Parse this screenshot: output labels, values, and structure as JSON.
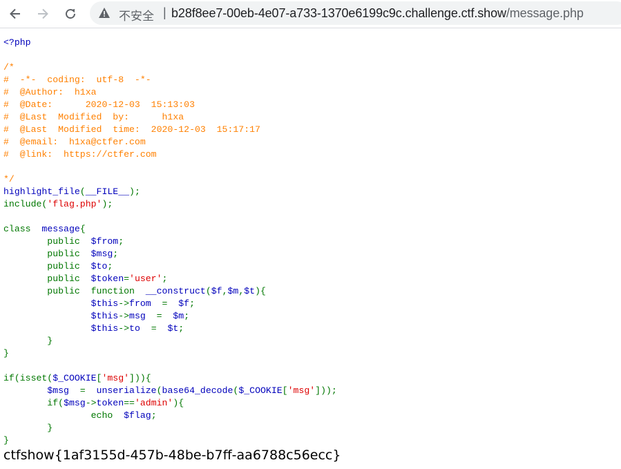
{
  "browser": {
    "back_icon": "arrow-left-icon",
    "forward_icon": "arrow-right-icon",
    "reload_icon": "reload-icon",
    "security_icon": "warning-triangle-icon",
    "security_label": "不安全",
    "separator": "|",
    "url_host": "b28f8ee7-00eb-4e07-a733-1370e6199c9c.challenge.ctf.show",
    "url_path": "/message.php"
  },
  "source_lines": [
    [
      {
        "t": "<?php",
        "c": "html"
      }
    ],
    [],
    [
      {
        "t": "/*",
        "c": "cmt"
      }
    ],
    [
      {
        "t": "#  -*-  coding:  utf-8  -*-",
        "c": "cmt"
      }
    ],
    [
      {
        "t": "#  @Author:  h1xa",
        "c": "cmt"
      }
    ],
    [
      {
        "t": "#  @Date:      2020-12-03  15:13:03",
        "c": "cmt"
      }
    ],
    [
      {
        "t": "#  @Last  Modified  by:      h1xa",
        "c": "cmt"
      }
    ],
    [
      {
        "t": "#  @Last  Modified  time:  2020-12-03  15:17:17",
        "c": "cmt"
      }
    ],
    [
      {
        "t": "#  @email:  h1xa@ctfer.com",
        "c": "cmt"
      }
    ],
    [
      {
        "t": "#  @link:  https://ctfer.com",
        "c": "cmt"
      }
    ],
    [],
    [
      {
        "t": "*/",
        "c": "cmt"
      }
    ],
    [
      {
        "t": "highlight_file",
        "c": "def"
      },
      {
        "t": "(",
        "c": "kw"
      },
      {
        "t": "__FILE__",
        "c": "def"
      },
      {
        "t": ");",
        "c": "kw"
      }
    ],
    [
      {
        "t": "include(",
        "c": "kw"
      },
      {
        "t": "'flag.php'",
        "c": "str"
      },
      {
        "t": ");",
        "c": "kw"
      }
    ],
    [],
    [
      {
        "t": "class  ",
        "c": "kw"
      },
      {
        "t": "message",
        "c": "def"
      },
      {
        "t": "{",
        "c": "kw"
      }
    ],
    [
      {
        "t": "        public  ",
        "c": "kw"
      },
      {
        "t": "$from",
        "c": "def"
      },
      {
        "t": ";",
        "c": "kw"
      }
    ],
    [
      {
        "t": "        public  ",
        "c": "kw"
      },
      {
        "t": "$msg",
        "c": "def"
      },
      {
        "t": ";",
        "c": "kw"
      }
    ],
    [
      {
        "t": "        public  ",
        "c": "kw"
      },
      {
        "t": "$to",
        "c": "def"
      },
      {
        "t": ";",
        "c": "kw"
      }
    ],
    [
      {
        "t": "        public  ",
        "c": "kw"
      },
      {
        "t": "$token",
        "c": "def"
      },
      {
        "t": "=",
        "c": "kw"
      },
      {
        "t": "'user'",
        "c": "str"
      },
      {
        "t": ";",
        "c": "kw"
      }
    ],
    [
      {
        "t": "        public  function  ",
        "c": "kw"
      },
      {
        "t": "__construct",
        "c": "def"
      },
      {
        "t": "(",
        "c": "kw"
      },
      {
        "t": "$f",
        "c": "def"
      },
      {
        "t": ",",
        "c": "kw"
      },
      {
        "t": "$m",
        "c": "def"
      },
      {
        "t": ",",
        "c": "kw"
      },
      {
        "t": "$t",
        "c": "def"
      },
      {
        "t": "){",
        "c": "kw"
      }
    ],
    [
      {
        "t": "                ",
        "c": "kw"
      },
      {
        "t": "$this",
        "c": "def"
      },
      {
        "t": "->",
        "c": "kw"
      },
      {
        "t": "from  ",
        "c": "def"
      },
      {
        "t": "=  ",
        "c": "kw"
      },
      {
        "t": "$f",
        "c": "def"
      },
      {
        "t": ";",
        "c": "kw"
      }
    ],
    [
      {
        "t": "                ",
        "c": "kw"
      },
      {
        "t": "$this",
        "c": "def"
      },
      {
        "t": "->",
        "c": "kw"
      },
      {
        "t": "msg  ",
        "c": "def"
      },
      {
        "t": "=  ",
        "c": "kw"
      },
      {
        "t": "$m",
        "c": "def"
      },
      {
        "t": ";",
        "c": "kw"
      }
    ],
    [
      {
        "t": "                ",
        "c": "kw"
      },
      {
        "t": "$this",
        "c": "def"
      },
      {
        "t": "->",
        "c": "kw"
      },
      {
        "t": "to  ",
        "c": "def"
      },
      {
        "t": "=  ",
        "c": "kw"
      },
      {
        "t": "$t",
        "c": "def"
      },
      {
        "t": ";",
        "c": "kw"
      }
    ],
    [
      {
        "t": "        }",
        "c": "kw"
      }
    ],
    [
      {
        "t": "}",
        "c": "kw"
      }
    ],
    [],
    [
      {
        "t": "if(isset(",
        "c": "kw"
      },
      {
        "t": "$_COOKIE",
        "c": "def"
      },
      {
        "t": "[",
        "c": "kw"
      },
      {
        "t": "'msg'",
        "c": "str"
      },
      {
        "t": "])){",
        "c": "kw"
      }
    ],
    [
      {
        "t": "        ",
        "c": "kw"
      },
      {
        "t": "$msg  ",
        "c": "def"
      },
      {
        "t": "=  ",
        "c": "kw"
      },
      {
        "t": "unserialize",
        "c": "def"
      },
      {
        "t": "(",
        "c": "kw"
      },
      {
        "t": "base64_decode",
        "c": "def"
      },
      {
        "t": "(",
        "c": "kw"
      },
      {
        "t": "$_COOKIE",
        "c": "def"
      },
      {
        "t": "[",
        "c": "kw"
      },
      {
        "t": "'msg'",
        "c": "str"
      },
      {
        "t": "]));",
        "c": "kw"
      }
    ],
    [
      {
        "t": "        if(",
        "c": "kw"
      },
      {
        "t": "$msg",
        "c": "def"
      },
      {
        "t": "->",
        "c": "kw"
      },
      {
        "t": "token",
        "c": "def"
      },
      {
        "t": "==",
        "c": "kw"
      },
      {
        "t": "'admin'",
        "c": "str"
      },
      {
        "t": "){",
        "c": "kw"
      }
    ],
    [
      {
        "t": "                echo  ",
        "c": "kw"
      },
      {
        "t": "$flag",
        "c": "def"
      },
      {
        "t": ";",
        "c": "kw"
      }
    ],
    [
      {
        "t": "        }",
        "c": "kw"
      }
    ],
    [
      {
        "t": "}",
        "c": "kw"
      }
    ]
  ],
  "flag_output": "ctfshow{1af3155d-457b-48be-b7ff-aa6788c56ecc}",
  "colors": {
    "php_html": "#0000BB",
    "php_comment": "#FF8000",
    "php_default": "#0000BB",
    "php_keyword": "#007700",
    "php_string": "#DD0000"
  }
}
